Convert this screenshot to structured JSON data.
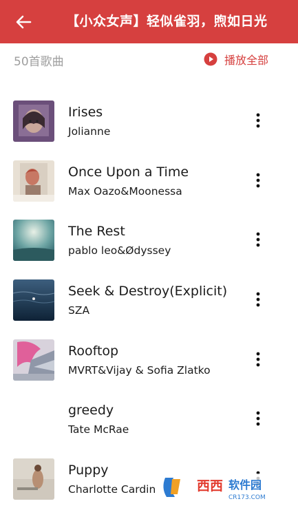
{
  "header": {
    "title": "【小众女声】轻似雀羽，煦如日光"
  },
  "subbar": {
    "count": "50首歌曲",
    "play_all": "播放全部"
  },
  "accent": "#d6403f",
  "songs": [
    {
      "title": "Irises",
      "artist": "Jolianne",
      "cover": "purple-portrait"
    },
    {
      "title": "Once Upon a Time",
      "artist": "Max Oazo&Moonessa",
      "cover": "red-hair-girl"
    },
    {
      "title": "The Rest",
      "artist": "pablo leo&Ødyssey",
      "cover": "teal-sky"
    },
    {
      "title": "Seek & Destroy(Explicit)",
      "artist": "SZA",
      "cover": "dark-sea"
    },
    {
      "title": "Rooftop",
      "artist": "MVRT&Vijay & Sofia Zlatko",
      "cover": "pink-hair"
    },
    {
      "title": "greedy",
      "artist": "Tate McRae",
      "cover": "blank"
    },
    {
      "title": "Puppy",
      "artist": "Charlotte Cardin",
      "cover": "beige-figure"
    }
  ],
  "watermark": {
    "brand": "西西软件园",
    "url": "CR173.COM"
  }
}
